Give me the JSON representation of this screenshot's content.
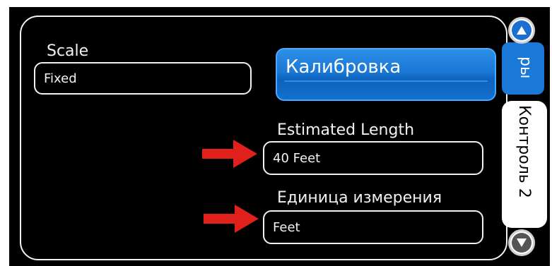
{
  "left": {
    "scale_label": "Scale",
    "scale_value": "Fixed"
  },
  "right": {
    "calibration_button": "Калибровка",
    "estimated_length_label": "Estimated Length",
    "estimated_length_value": "40 Feet",
    "units_label": "Единица измерения",
    "units_value": "Feet"
  },
  "side_tabs": {
    "tab_active_label": "ры",
    "tab_control_label": "Контроль 2"
  },
  "colors": {
    "accent_blue": "#1a78d6",
    "scroll_up_blue": "#1a6fd0",
    "scroll_down_gray": "#555555",
    "arrow_red": "#e0201a"
  },
  "icons": {
    "scroll_up": "arrow-up-circle-icon",
    "scroll_down": "arrow-down-circle-icon",
    "annotation": "red-arrow-icon"
  }
}
